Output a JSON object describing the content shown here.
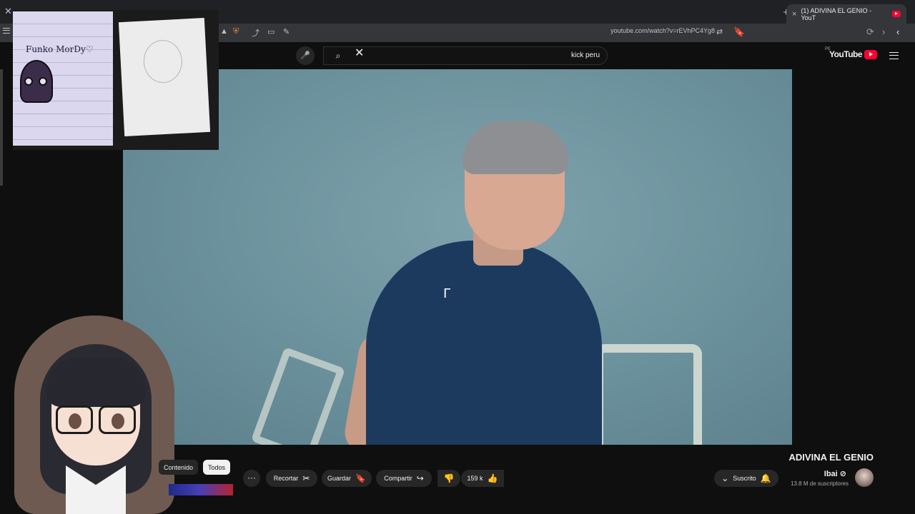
{
  "browser": {
    "tab_title": "(1) ADIVINA EL GENIO - YouT",
    "tab_close": "×",
    "new_tab": "+",
    "window_close": "✕",
    "url": "youtube.com/watch?v=rEVhPC4Yg8"
  },
  "header": {
    "search_value": "kick peru",
    "logo_text": "YouTube",
    "logo_region": "PE"
  },
  "video": {
    "title": "ADIVINA EL GENIO",
    "channel_name": "Ibai ⊘",
    "subscribers": "13.8 M de suscriptores"
  },
  "actions": {
    "subscribed_label": "Suscrito",
    "likes": "159 k",
    "share_label": "Compartir",
    "save_label": "Guardar",
    "clip_label": "Recortar",
    "more_label": "···"
  },
  "chips": {
    "all": "Todos",
    "content": "Contenido"
  },
  "overlay": {
    "drawing_caption": "Funko MorDy♡"
  },
  "colors": {
    "background": "#0f0f0f",
    "yt_red": "#ff0033",
    "button_bg": "#272727",
    "video_bg": "#6e949f"
  },
  "icons": {
    "search": "⌕",
    "mic": "🎤",
    "clear": "✕",
    "bell": "🔔",
    "like": "👍",
    "dislike": "👎",
    "share": "↪",
    "save": "🔖",
    "clip": "✂",
    "reload": "⟳",
    "back": "‹",
    "forward": "›",
    "bookmark": "🔖"
  }
}
